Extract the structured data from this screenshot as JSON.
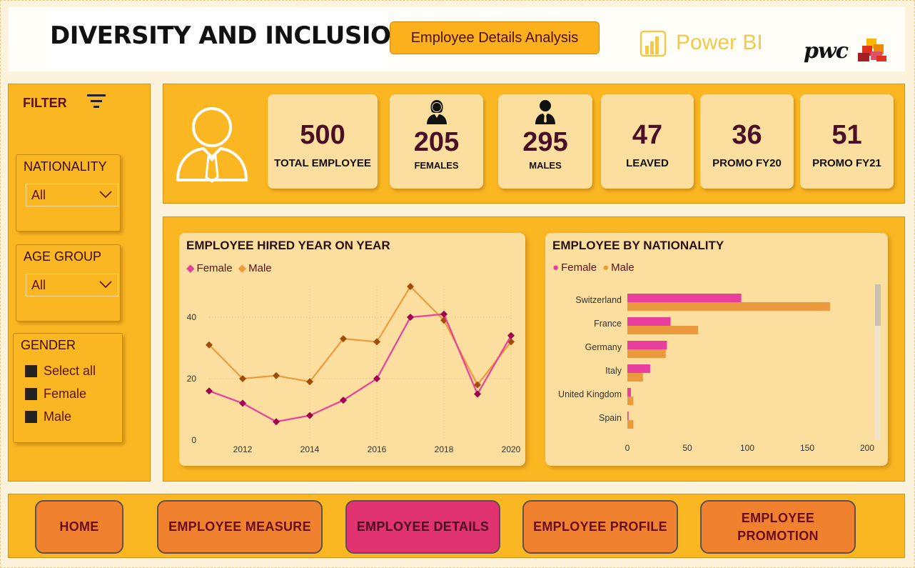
{
  "header": {
    "title": "DIVERSITY AND INCLUSION",
    "subtitle": "Employee Details Analysis",
    "powerbi_label": "Power BI",
    "pwc_label": "pwc"
  },
  "filter": {
    "label": "FILTER",
    "nationality": {
      "title": "NATIONALITY",
      "value": "All"
    },
    "age_group": {
      "title": "AGE GROUP",
      "value": "All"
    },
    "gender": {
      "title": "GENDER",
      "options": [
        "Select all",
        "Female",
        "Male"
      ]
    }
  },
  "kpis": [
    {
      "value": "500",
      "label": "TOTAL EMPLOYEE"
    },
    {
      "value": "205",
      "label": "FEMALES",
      "icon": "female-user-icon"
    },
    {
      "value": "295",
      "label": "MALES",
      "icon": "male-user-icon"
    },
    {
      "value": "47",
      "label": "LEAVED"
    },
    {
      "value": "36",
      "label": "PROMO FY20"
    },
    {
      "value": "51",
      "label": "PROMO FY21"
    }
  ],
  "colors": {
    "female": "#e83e9d",
    "male": "#ec9a3e",
    "female_marker": "#a0004f",
    "male_marker": "#a14c08",
    "panel": "#fbb722",
    "card": "#fcdf9e"
  },
  "chart_data": [
    {
      "type": "line",
      "title": "EMPLOYEE HIRED YEAR ON YEAR",
      "x": [
        2011,
        2012,
        2013,
        2014,
        2015,
        2016,
        2017,
        2018,
        2019,
        2020
      ],
      "x_ticks": [
        2012,
        2014,
        2016,
        2018,
        2020
      ],
      "y_ticks": [
        0,
        20,
        40
      ],
      "ylim": [
        0,
        50
      ],
      "grid": true,
      "legend": "top-left",
      "series": [
        {
          "name": "Female",
          "values": [
            16,
            12,
            6,
            8,
            13,
            20,
            40,
            41,
            15,
            34
          ]
        },
        {
          "name": "Male",
          "values": [
            31,
            20,
            21,
            19,
            33,
            32,
            50,
            39,
            18,
            32
          ]
        }
      ]
    },
    {
      "type": "bar",
      "orientation": "horizontal",
      "title": "EMPLOYEE BY NATIONALITY",
      "categories": [
        "Switzerland",
        "France",
        "Germany",
        "Italy",
        "United Kingdom",
        "Spain"
      ],
      "x_ticks": [
        0,
        50,
        100,
        150,
        200
      ],
      "xlim": [
        0,
        200
      ],
      "legend": "top-left",
      "series": [
        {
          "name": "Female",
          "values": [
            95,
            36,
            33,
            19,
            3,
            1
          ]
        },
        {
          "name": "Male",
          "values": [
            169,
            59,
            32,
            13,
            5,
            5
          ]
        }
      ]
    }
  ],
  "nav": {
    "items": [
      "HOME",
      "EMPLOYEE MEASURE",
      "EMPLOYEE DETAILS",
      "EMPLOYEE PROFILE",
      "EMPLOYEE PROMOTION"
    ],
    "active": "EMPLOYEE DETAILS"
  }
}
